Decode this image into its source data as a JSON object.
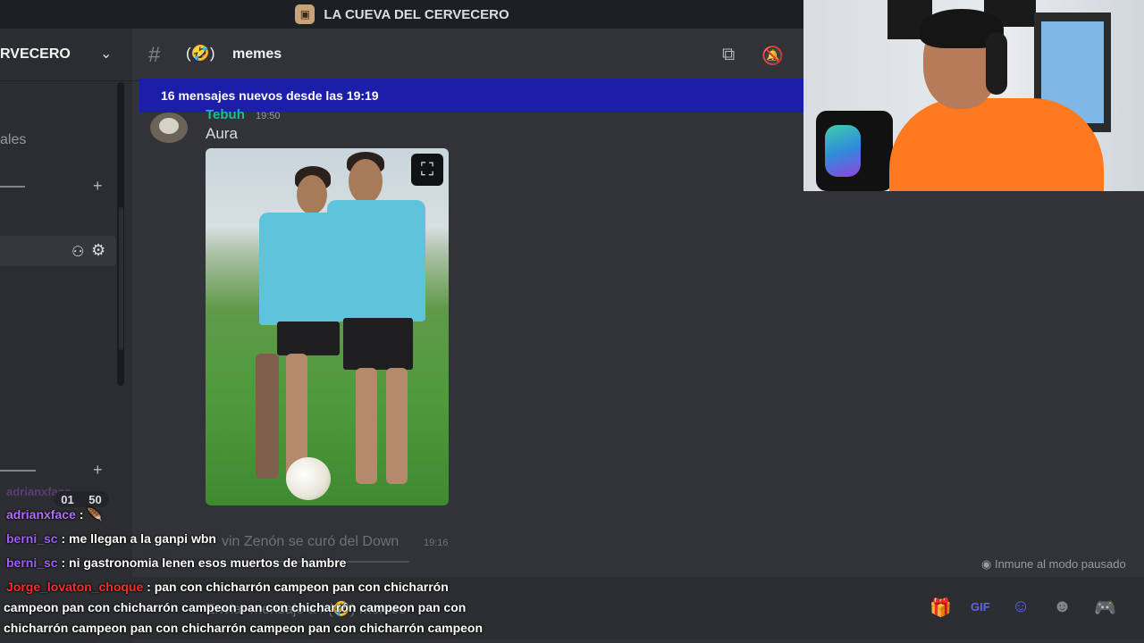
{
  "window": {
    "title": "LA CUEVA DEL CERVECERO"
  },
  "sidebar": {
    "server_name_visible": "RVECERO",
    "text_fragment": "ales",
    "icons": {
      "chevron": "chevron-down-icon",
      "plus": "plus-icon",
      "add_member": "add-member-icon",
      "settings": "gear-icon"
    }
  },
  "channel": {
    "hash": "#",
    "emoji": "(🤣)",
    "name": "memes",
    "new_messages_banner": "16 mensajes nuevos desde las 19:19"
  },
  "message": {
    "author": "Tebuh",
    "time": "19:50",
    "text": "Aura"
  },
  "ghost_message": {
    "text": "vin Zenón se curó del Down",
    "time": "19:16"
  },
  "composer": {
    "placeholder": "Enviar mensaje a #(🤣) memes",
    "immune_text": "Inmune al modo pausado"
  },
  "twitch_chat": {
    "faded_user": "adrianxface",
    "timer": {
      "a": "01",
      "b": "50"
    },
    "lines": [
      {
        "user": "adrianxface",
        "color": "#b86bff",
        "text": " : 🪶"
      },
      {
        "user": "berni_sc",
        "color": "#a25cff",
        "text": " : me llegan a la ganpi wbn"
      },
      {
        "user": "berni_sc",
        "color": "#a25cff",
        "text": " : ni gastronomia lenen esos muertos de hambre"
      },
      {
        "user": "Jorge_lovaton_choque",
        "color": "#ff2b2b",
        "text": " : pan con chicharrón campeon pan con chicharrón"
      }
    ],
    "wrapped": [
      "campeon pan con chicharrón campeon pan con chicharrón campeon pan con",
      "chicharrón campeon pan con chicharrón campeon pan con chicharrón campeon"
    ]
  }
}
